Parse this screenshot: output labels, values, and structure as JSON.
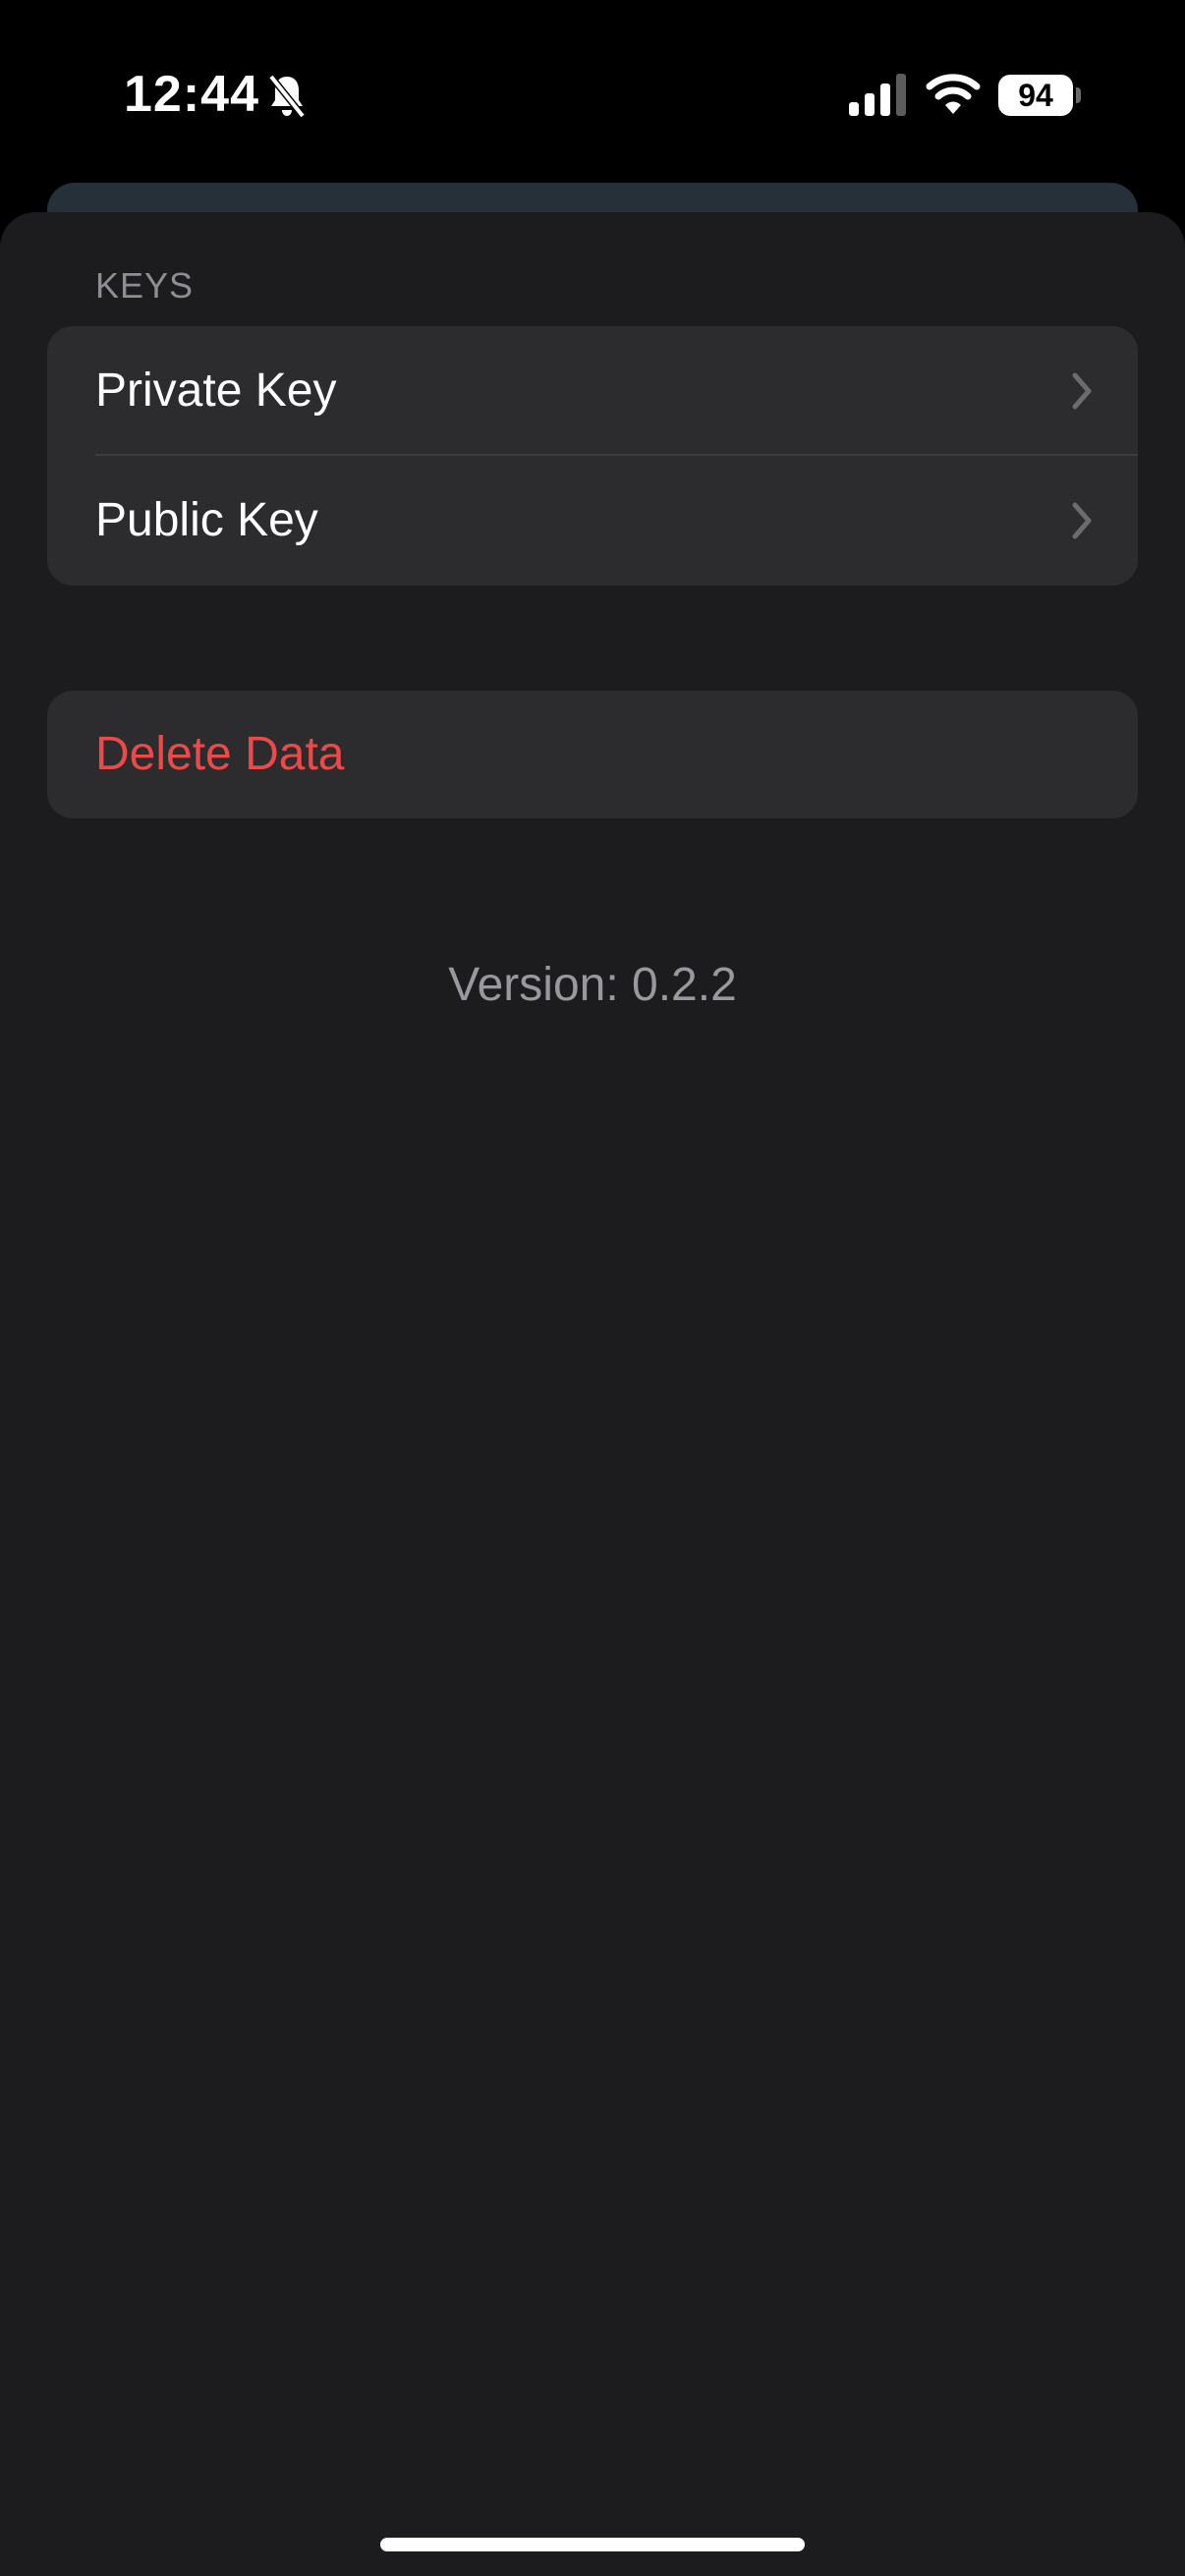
{
  "status_bar": {
    "time": "12:44",
    "battery_level": "94",
    "icons": [
      "bell-slash-icon",
      "cellular-signal-icon",
      "wifi-icon",
      "battery-icon"
    ]
  },
  "keys_section": {
    "header": "KEYS",
    "items": [
      {
        "label": "Private Key",
        "icon": "chevron-right-icon"
      },
      {
        "label": "Public Key",
        "icon": "chevron-right-icon"
      }
    ]
  },
  "danger_section": {
    "delete_label": "Delete Data"
  },
  "footer": {
    "version": "Version: 0.2.2"
  },
  "colors": {
    "background": "#1c1c1e",
    "cell": "#2c2c2e",
    "destructive": "#eb4a48",
    "secondary_text": "#98989e"
  }
}
